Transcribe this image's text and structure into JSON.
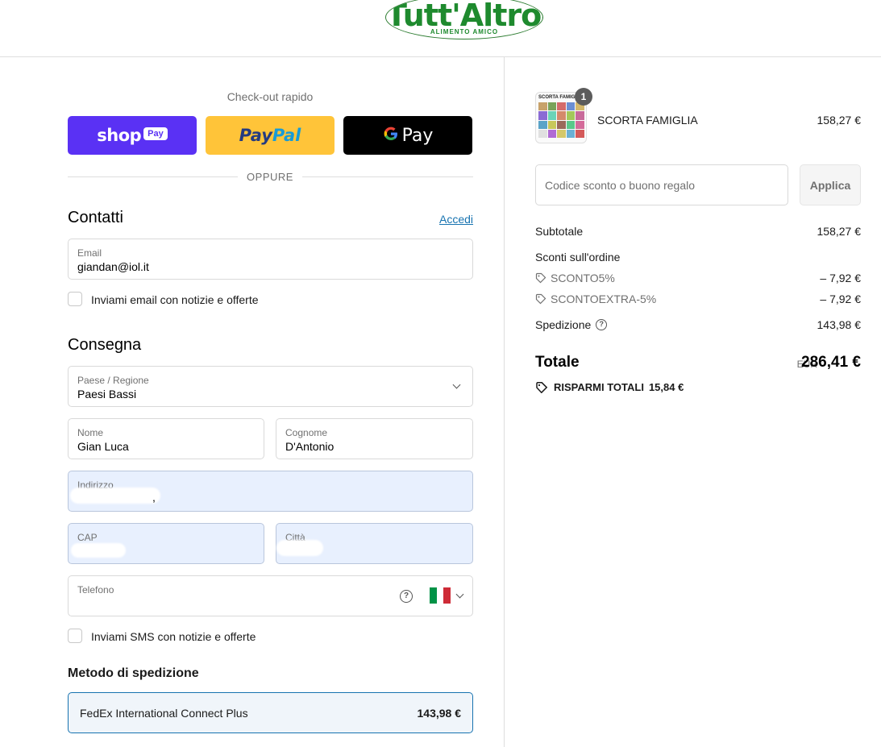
{
  "header": {
    "logo_text": "Tutt'Altro",
    "logo_tagline": "ALIMENTO AMICO",
    "logo_reg": "®"
  },
  "express": {
    "title": "Check-out rapido",
    "shop_word": "shop",
    "shop_pay": "Pay",
    "paypal_part1": "Pay",
    "paypal_part2": "Pal",
    "gpay_g": "G",
    "gpay_word": "Pay",
    "or_text": "OPPURE"
  },
  "contact": {
    "title": "Contatti",
    "login_link": "Accedi",
    "email_label": "Email",
    "email_value": "giandan@iol.it",
    "newsletter_label": "Inviami email con notizie e offerte"
  },
  "delivery": {
    "title": "Consegna",
    "country_label": "Paese / Regione",
    "country_value": "Paesi Bassi",
    "first_name_label": "Nome",
    "first_name_value": "Gian Luca",
    "last_name_label": "Cognome",
    "last_name_value": "D'Antonio",
    "address_label": "Indirizzo",
    "address_value": ",",
    "zip_label": "CAP",
    "city_label": "Città",
    "phone_label": "Telefono",
    "help_icon": "?",
    "sms_label": "Inviami SMS con notizie e offerte",
    "flag_colors": [
      "#009246",
      "#ffffff",
      "#ce2b37"
    ]
  },
  "shipping": {
    "title": "Metodo di spedizione",
    "option_name": "FedEx International Connect Plus",
    "option_price": "143,98 €"
  },
  "summary": {
    "product_thumb_title": "SCORTA FAMIGLIA",
    "product_qty": "1",
    "product_name": "SCORTA FAMIGLIA",
    "product_price": "158,27 €",
    "discount_placeholder": "Codice sconto o buono regalo",
    "apply_label": "Applica",
    "subtotal_label": "Subtotale",
    "subtotal_value": "158,27 €",
    "discounts_label": "Sconti sull'ordine",
    "codes": [
      {
        "name": "SCONTO5%",
        "amount": "– 7,92 €"
      },
      {
        "name": "SCONTOEXTRA-5%",
        "amount": "– 7,92 €"
      }
    ],
    "shipping_label": "Spedizione",
    "shipping_value": "143,98 €",
    "total_label": "Totale",
    "total_currency": "EUR",
    "total_value": "286,41 €",
    "savings_label": "RISPARMI TOTALI",
    "savings_value": "15,84 €"
  }
}
